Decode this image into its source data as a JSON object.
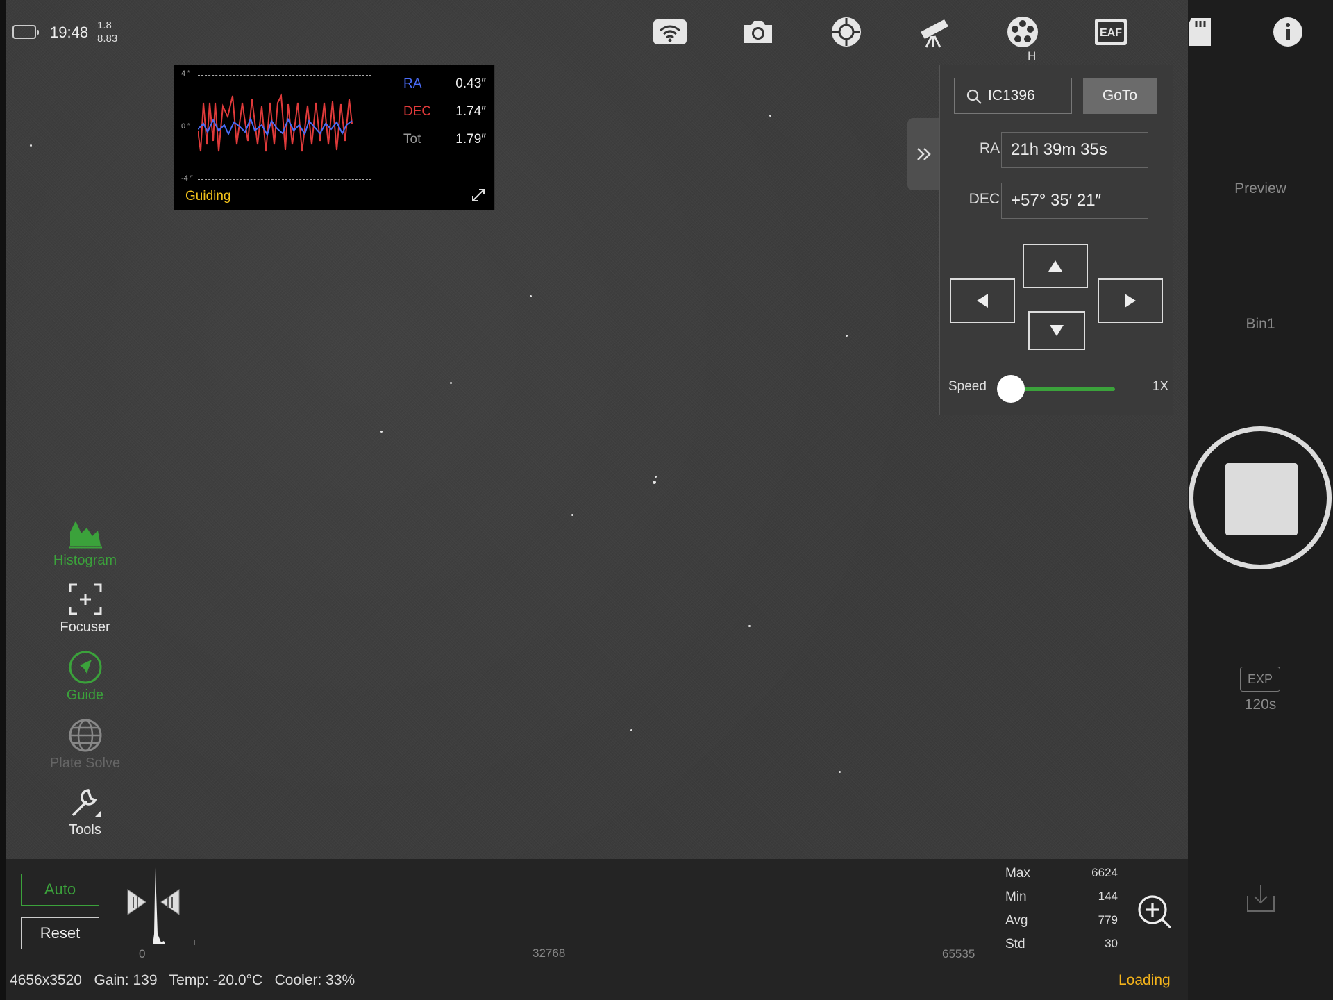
{
  "status": {
    "time": "19:48",
    "version_top": "1.8",
    "version_bottom": "8.83"
  },
  "toolbar": {
    "icons": [
      "wifi-icon",
      "camera-icon",
      "guide-scope-icon",
      "telescope-icon",
      "filter-wheel-icon",
      "eaf-icon",
      "sd-card-icon",
      "info-icon"
    ],
    "eaf_label": "EAF",
    "filter_letter": "H"
  },
  "guiding": {
    "title": "Guiding",
    "tick_top": "4 ″",
    "tick_mid": "0 ″",
    "tick_bottom": "-4 ″",
    "ra_label": "RA",
    "ra_value": "0.43″",
    "dec_label": "DEC",
    "dec_value": "1.74″",
    "tot_label": "Tot",
    "tot_value": "1.79″",
    "colors": {
      "ra": "#4a6cf7",
      "dec": "#e03a3a",
      "title": "#f2c21b"
    }
  },
  "mount": {
    "search_value": "IC1396",
    "goto_label": "GoTo",
    "ra_label": "RA",
    "ra_value": "21h 39m 35s",
    "dec_label": "DEC",
    "dec_value": "+57° 35′ 21″",
    "speed_label": "Speed",
    "speed_value": "1X"
  },
  "rail": {
    "preview_label": "Preview",
    "bin_label": "Bin1",
    "exp_label": "EXP",
    "exp_value": "120s"
  },
  "tools": {
    "histogram": "Histogram",
    "focuser": "Focuser",
    "guide": "Guide",
    "plate_solve": "Plate Solve",
    "tools": "Tools",
    "active_color": "#3ba23b"
  },
  "histogram": {
    "auto_label": "Auto",
    "reset_label": "Reset",
    "axis_min": "0",
    "axis_mid": "32768",
    "axis_max": "65535",
    "max_label": "Max",
    "max_value": "6624",
    "min_label": "Min",
    "min_value": "144",
    "avg_label": "Avg",
    "avg_value": "779",
    "std_label": "Std",
    "std_value": "30"
  },
  "footer": {
    "resolution": "4656x3520",
    "gain": "Gain: 139",
    "temp": "Temp: -20.0°C",
    "cooler": "Cooler: 33%",
    "loading": "Loading"
  }
}
